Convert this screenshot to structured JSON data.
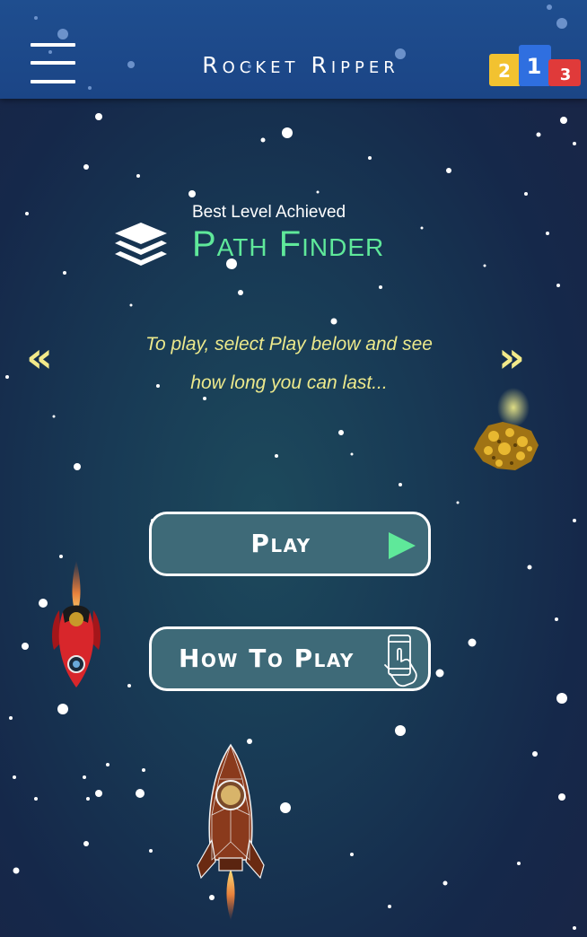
{
  "header": {
    "title": "Rocket Ripper",
    "menu_icon": "hamburger-menu-icon",
    "leaderboard_icon": "leaderboard-podium-icon",
    "podium": {
      "first": "1",
      "second": "2",
      "third": "3"
    }
  },
  "best": {
    "caption": "Best Level Achieved",
    "level": "Path Finder",
    "icon": "layers-icon"
  },
  "carousel": {
    "prev_glyph": "«",
    "next_glyph": "»",
    "hint_line1": "To play, select Play below and see",
    "hint_line2": "how long you can last..."
  },
  "buttons": {
    "play_label": "Play",
    "how_label": "How To Play"
  },
  "colors": {
    "accent_green": "#5fe89a",
    "hint_yellow": "#ece98c",
    "header_blue": "#1f4e8f",
    "button_fill": "#3e6a78"
  }
}
